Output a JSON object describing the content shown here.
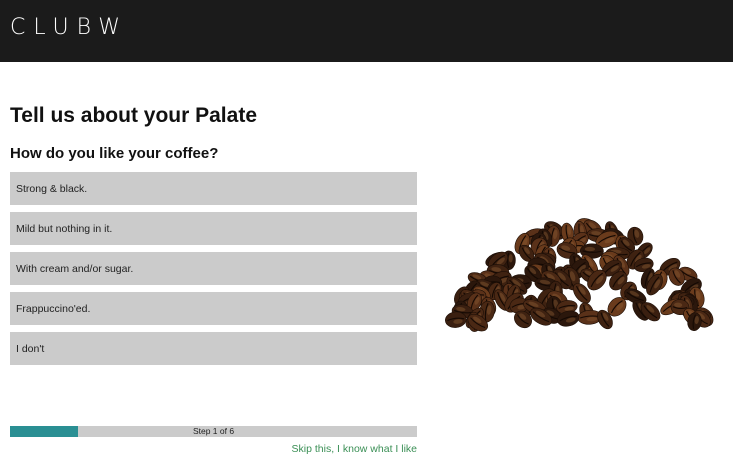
{
  "header": {
    "brand": "CLUBW",
    "background": "#1b1b1b"
  },
  "main": {
    "title": "Tell us about your Palate",
    "question": "How do you like your coffee?",
    "options": [
      {
        "label": "Strong & black."
      },
      {
        "label": "Mild but nothing in it."
      },
      {
        "label": "With cream and/or sugar."
      },
      {
        "label": "Frappuccino'ed."
      },
      {
        "label": "I don't"
      }
    ],
    "image_icon": "coffee-beans-image"
  },
  "progress": {
    "label": "Step 1 of 6",
    "value": 0.167,
    "fill_color": "#2a8f93"
  },
  "footer": {
    "skip_label": "Skip this, I know what I like",
    "link_color": "#3a8f55"
  }
}
